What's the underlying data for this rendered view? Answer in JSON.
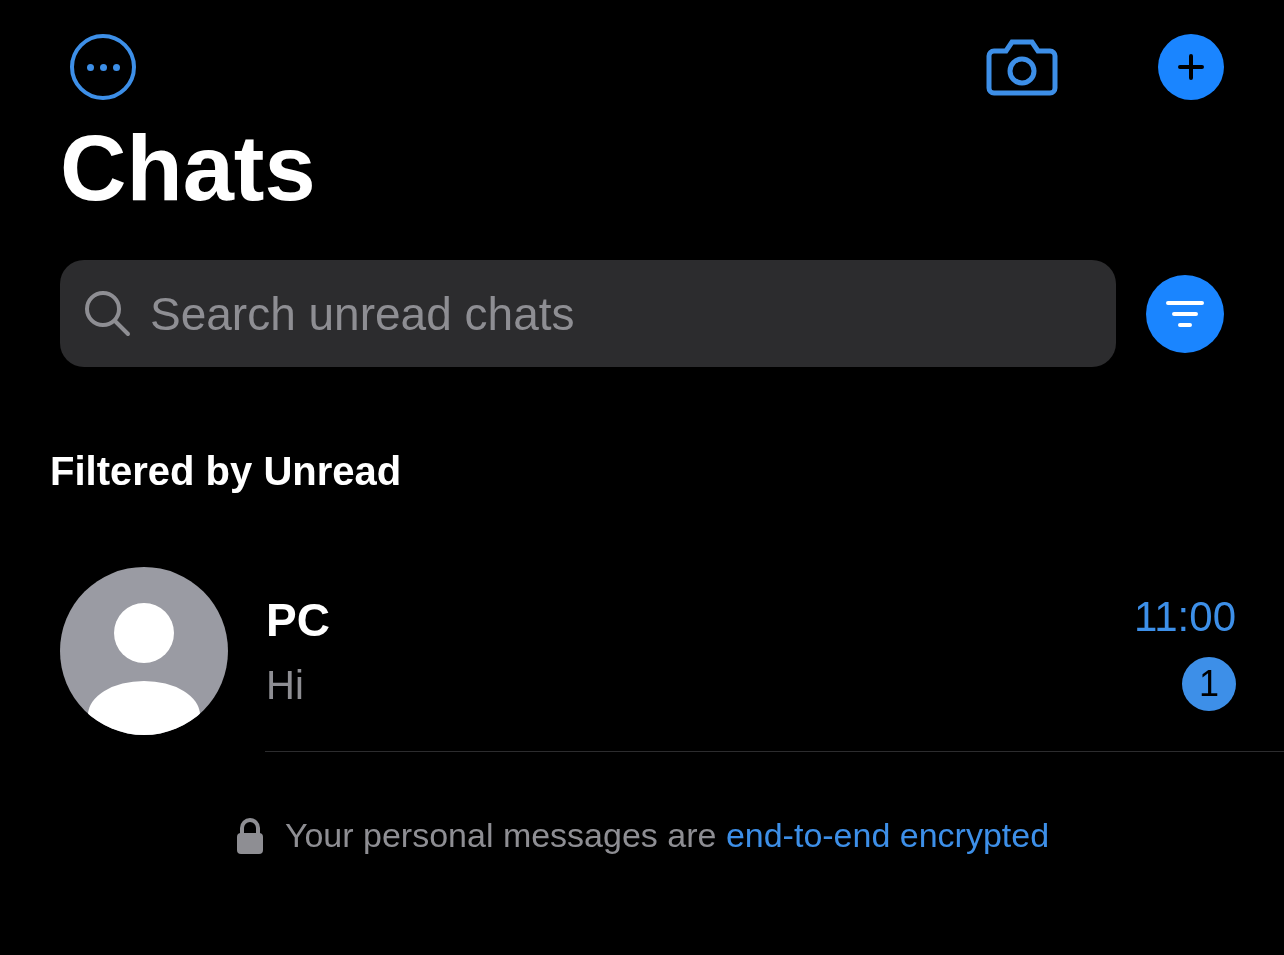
{
  "title": "Chats",
  "search": {
    "placeholder": "Search unread chats"
  },
  "filter_label": "Filtered by Unread",
  "chats": [
    {
      "name": "PC",
      "preview": "Hi",
      "time": "11:00",
      "unread_count": "1"
    }
  ],
  "footer": {
    "text": "Your personal messages are ",
    "link": "end-to-end encrypted"
  }
}
